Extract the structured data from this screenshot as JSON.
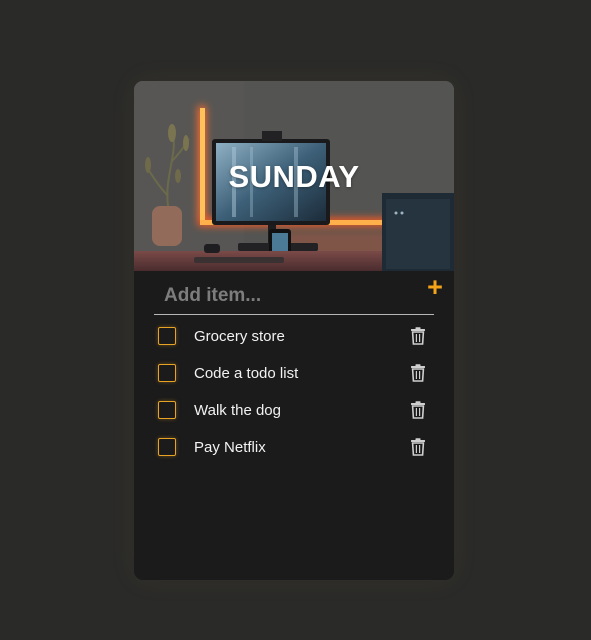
{
  "header": {
    "title": "SUNDAY"
  },
  "add_item": {
    "placeholder": "Add item...",
    "button_icon": "plus-icon"
  },
  "todos": [
    {
      "label": "Grocery store",
      "checked": false,
      "delete_icon": "trash-icon"
    },
    {
      "label": "Code a todo list",
      "checked": false,
      "delete_icon": "trash-icon"
    },
    {
      "label": "Walk the dog",
      "checked": false,
      "delete_icon": "trash-icon"
    },
    {
      "label": "Pay Netflix",
      "checked": false,
      "delete_icon": "trash-icon"
    }
  ],
  "colors": {
    "background": "#2a2a29",
    "card": "#1b1b1b",
    "accent": "#f4a418",
    "text": "#f2f2f2",
    "placeholder": "#7d7d7d"
  }
}
